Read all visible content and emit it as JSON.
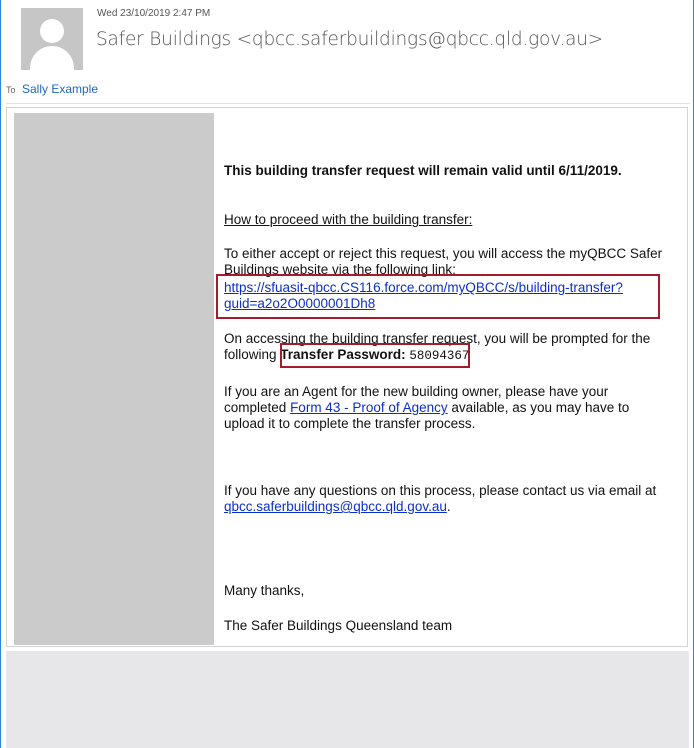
{
  "header": {
    "sent_date": "Wed 23/10/2019 2:47 PM",
    "sender": "Safer Buildings <qbcc.saferbuildings@qbcc.qld.gov.au>",
    "to_label": "To",
    "to_name": "Sally Example"
  },
  "body": {
    "validity": "This building transfer request will remain valid until 6/11/2019.",
    "proceed_heading": "How to proceed with the building transfer:",
    "access_line1": "To either accept or reject this request, you will access the myQBCC Safer",
    "access_line2": "Buildings website via the following link:",
    "link_line1": "https://sfuasit-qbcc.CS116.force.com/myQBCC/s/building-transfer?",
    "link_line2": "guid=a2o2O0000001Dh8",
    "prompt_line1": "On accessing the building transfer request, you will be prompted for the",
    "prompt_line2_prefix": "following",
    "password_label": "Transfer Password:",
    "password_value": "58094367",
    "agent_line1": "If you are an Agent for the new building owner, please have your",
    "agent_line2_prefix": "completed",
    "agent_link": "Form 43 - Proof of Agency",
    "agent_line2_suffix": "available, as you may have to",
    "agent_line3": "upload it to complete the transfer process.",
    "questions_line1": "If you have any questions on this process, please contact us via email at",
    "questions_email": "qbcc.saferbuildings@qbcc.qld.gov.au",
    "questions_suffix": ".",
    "thanks": "Many thanks,",
    "signature": "The Safer Buildings Queensland team"
  },
  "colors": {
    "accent_border": "#2b88d8",
    "highlight_box": "#a31c2d",
    "link": "#0a2fcc"
  }
}
